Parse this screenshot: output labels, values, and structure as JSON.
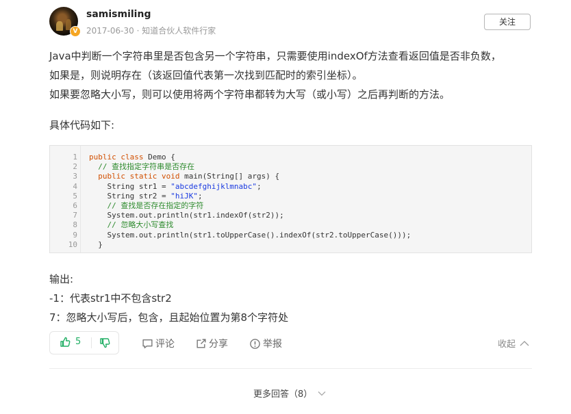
{
  "user": {
    "name": "samismiling",
    "date": "2017-06-30",
    "separator": "·",
    "title": "知道合伙人软件行家",
    "badge": "V"
  },
  "follow_label": "关注",
  "answer": {
    "para1_line1": "Java中判断一个字符串里是否包含另一个字符串，只需要使用indexOf方法查看返回值是否非负数，",
    "para1_line2": "如果是，则说明存在（该返回值代表第一次找到匹配时的索引坐标）。",
    "para2": "如果要忽略大小写，则可以使用将两个字符串都转为大写（或小写）之后再判断的方法。",
    "code_intro": "具体代码如下:",
    "output_label": "输出:",
    "output_line1": "-1：代表str1中不包含str2",
    "output_line2": "7：忽略大小写后，包含，且起始位置为第8个字符处"
  },
  "code": {
    "line_numbers": [
      "1",
      "2",
      "3",
      "4",
      "5",
      "6",
      "7",
      "8",
      "9",
      "10"
    ],
    "l1_kw": "public class",
    "l1_rest": " Demo {",
    "l2_comment": "// 查找指定字符串是否存在",
    "l3_kw": "public static void",
    "l3_rest": " main(String[] args) {",
    "l4_a": "String str1 = ",
    "l4_str": "\"abcdefghijklmnabc\"",
    "l4_b": ";",
    "l5_a": "String str2 = ",
    "l5_str": "\"hiJK\"",
    "l5_b": ";",
    "l6_comment": "// 查找是否存在指定的字符",
    "l7": "System.out.println(str1.indexOf(str2));",
    "l8_comment": "// 忽略大小写查找",
    "l9": "System.out.println(str1.toUpperCase().indexOf(str2.toUpperCase()));",
    "l10": "}"
  },
  "actions": {
    "upvote_count": "5",
    "comment": "评论",
    "share": "分享",
    "report": "举报",
    "collapse": "收起"
  },
  "more_answers": "更多回答（8）",
  "icons": {
    "upvote": "thumbs-up-icon",
    "downvote": "thumbs-down-icon",
    "comment": "comment-icon",
    "share": "share-icon",
    "report": "report-icon",
    "collapse": "chevron-up-icon",
    "more": "chevron-down-icon"
  },
  "colors": {
    "vote_green": "#1fae63",
    "badge": "#f5a623",
    "keyword": "#d14f00",
    "string": "#1a3ae0",
    "comment": "#2d8a2d"
  }
}
